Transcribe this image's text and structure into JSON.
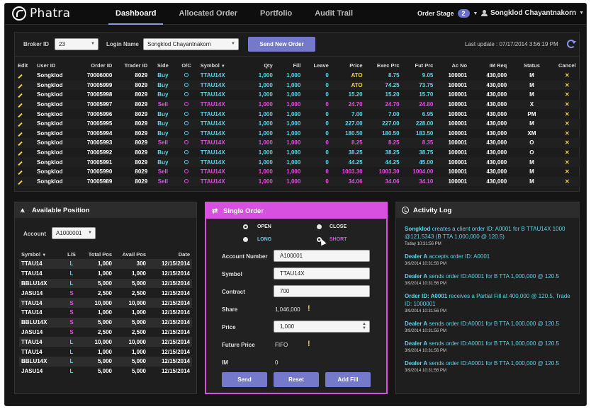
{
  "app": {
    "name": "Phatra"
  },
  "nav": {
    "tabs": [
      {
        "label": "Dashboard"
      },
      {
        "label": "Allocated Order"
      },
      {
        "label": "Portfolio"
      },
      {
        "label": "Audit Trail"
      }
    ]
  },
  "header": {
    "order_stage_label": "Order Stage",
    "order_stage_count": "2",
    "user_name": "Songklod Chayantnakorn"
  },
  "filters": {
    "broker_id_label": "Broker ID",
    "broker_id_value": "23",
    "login_name_label": "Login Name",
    "login_name_value": "Songklod Chayantnakorn",
    "send_new_order_label": "Send New Order",
    "last_update": "Last update : 07/17/2014   3:56:19 PM"
  },
  "orders": {
    "columns": [
      "Edit",
      "User ID",
      "Order ID",
      "Trader ID",
      "Side",
      "O/C",
      "Symbol",
      "Qty",
      "Fill",
      "Leave",
      "Price",
      "Exec Prc",
      "Fut Prc",
      "Ac No",
      "IM Req",
      "Status",
      "Cancel"
    ],
    "rows": [
      {
        "user": "Songklod",
        "order_id": "70006000",
        "trader": "8029",
        "side": "Buy",
        "symbol": "TTAU14X",
        "qty": "1,000",
        "fill": "1,000",
        "leave": "0",
        "price": "ATO",
        "exec": "8.75",
        "fut": "9.05",
        "acno": "100001",
        "im": "430,000",
        "status": "M"
      },
      {
        "user": "Songklod",
        "order_id": "70005999",
        "trader": "8029",
        "side": "Buy",
        "symbol": "TTAU14X",
        "qty": "1,000",
        "fill": "1,000",
        "leave": "0",
        "price": "ATO",
        "exec": "74.25",
        "fut": "73.75",
        "acno": "100001",
        "im": "430,000",
        "status": "M"
      },
      {
        "user": "Songklod",
        "order_id": "70005998",
        "trader": "8029",
        "side": "Buy",
        "symbol": "TTAU14X",
        "qty": "1,000",
        "fill": "1,000",
        "leave": "0",
        "price": "15.20",
        "exec": "15.20",
        "fut": "15.70",
        "acno": "100001",
        "im": "430,000",
        "status": "M"
      },
      {
        "user": "Songklod",
        "order_id": "70005997",
        "trader": "8029",
        "side": "Sell",
        "symbol": "TTAU14X",
        "qty": "1,000",
        "fill": "1,000",
        "leave": "0",
        "price": "24.70",
        "exec": "24.70",
        "fut": "24.80",
        "acno": "100001",
        "im": "430,000",
        "status": "X"
      },
      {
        "user": "Songklod",
        "order_id": "70005996",
        "trader": "8029",
        "side": "Buy",
        "symbol": "TTAU14X",
        "qty": "1,000",
        "fill": "1,000",
        "leave": "0",
        "price": "7.00",
        "exec": "7.00",
        "fut": "6.95",
        "acno": "100001",
        "im": "430,000",
        "status": "PM"
      },
      {
        "user": "Songklod",
        "order_id": "70005995",
        "trader": "8029",
        "side": "Buy",
        "symbol": "TTAU14X",
        "qty": "1,000",
        "fill": "1,000",
        "leave": "0",
        "price": "227.00",
        "exec": "227.00",
        "fut": "228.00",
        "acno": "100001",
        "im": "430,000",
        "status": "M"
      },
      {
        "user": "Songklod",
        "order_id": "70005994",
        "trader": "8029",
        "side": "Buy",
        "symbol": "TTAU14X",
        "qty": "1,000",
        "fill": "1,000",
        "leave": "0",
        "price": "180.50",
        "exec": "180.50",
        "fut": "183.50",
        "acno": "100001",
        "im": "430,000",
        "status": "XM"
      },
      {
        "user": "Songklod",
        "order_id": "70005993",
        "trader": "8029",
        "side": "Sell",
        "symbol": "TTAU14X",
        "qty": "1,000",
        "fill": "1,000",
        "leave": "0",
        "price": "8.25",
        "exec": "8.25",
        "fut": "8.35",
        "acno": "100001",
        "im": "430,000",
        "status": "O"
      },
      {
        "user": "Songklod",
        "order_id": "70005992",
        "trader": "8029",
        "side": "Buy",
        "symbol": "TTAU14X",
        "qty": "1,000",
        "fill": "1,000",
        "leave": "0",
        "price": "38.25",
        "exec": "38.25",
        "fut": "38.75",
        "acno": "100001",
        "im": "430,000",
        "status": "O"
      },
      {
        "user": "Songklod",
        "order_id": "70005991",
        "trader": "8029",
        "side": "Buy",
        "symbol": "TTAU14X",
        "qty": "1,000",
        "fill": "1,000",
        "leave": "0",
        "price": "44.25",
        "exec": "44.25",
        "fut": "45.00",
        "acno": "100001",
        "im": "430,000",
        "status": "M"
      },
      {
        "user": "Songklod",
        "order_id": "70005990",
        "trader": "8029",
        "side": "Sell",
        "symbol": "TTAU14X",
        "qty": "1,000",
        "fill": "1,000",
        "leave": "0",
        "price": "1003.30",
        "exec": "1003.30",
        "fut": "1004.00",
        "acno": "100001",
        "im": "430,000",
        "status": "M"
      },
      {
        "user": "Songklod",
        "order_id": "70005989",
        "trader": "8029",
        "side": "Sell",
        "symbol": "TTAU14X",
        "qty": "1,000",
        "fill": "1,000",
        "leave": "0",
        "price": "34.06",
        "exec": "34.06",
        "fut": "34.10",
        "acno": "100001",
        "im": "430,000",
        "status": "M"
      }
    ]
  },
  "available_position": {
    "title": "Available Position",
    "account_label": "Account",
    "account_value": "A1000001",
    "columns": [
      "Symbol",
      "L/S",
      "Total Pos",
      "Avail Pos",
      "Date"
    ],
    "rows": [
      {
        "symbol": "TTAU14",
        "ls": "L",
        "total": "1,000",
        "avail": "300",
        "date": "12/15/2014"
      },
      {
        "symbol": "TTAU14",
        "ls": "L",
        "total": "1,000",
        "avail": "1,000",
        "date": "12/15/2014"
      },
      {
        "symbol": "BBLU14X",
        "ls": "L",
        "total": "5,000",
        "avail": "5,000",
        "date": "12/15/2014"
      },
      {
        "symbol": "JASU14",
        "ls": "S",
        "total": "2,500",
        "avail": "2,500",
        "date": "12/15/2014"
      },
      {
        "symbol": "TTAU14",
        "ls": "S",
        "total": "10,000",
        "avail": "10,000",
        "date": "12/15/2014"
      },
      {
        "symbol": "TTAU14",
        "ls": "S",
        "total": "1,000",
        "avail": "1,000",
        "date": "12/15/2014"
      },
      {
        "symbol": "BBLU14X",
        "ls": "S",
        "total": "5,000",
        "avail": "5,000",
        "date": "12/15/2014"
      },
      {
        "symbol": "JASU14",
        "ls": "S",
        "total": "2,500",
        "avail": "2,500",
        "date": "12/15/2014"
      },
      {
        "symbol": "TTAU14",
        "ls": "L",
        "total": "10,000",
        "avail": "10,000",
        "date": "12/15/2014"
      },
      {
        "symbol": "TTAU14",
        "ls": "L",
        "total": "1,000",
        "avail": "1,000",
        "date": "12/15/2014"
      },
      {
        "symbol": "BBLU14X",
        "ls": "L",
        "total": "5,000",
        "avail": "5,000",
        "date": "12/15/2014"
      },
      {
        "symbol": "JASU14",
        "ls": "L",
        "total": "5,000",
        "avail": "5,000",
        "date": "12/15/2014"
      }
    ]
  },
  "single_order": {
    "title": "Single Order",
    "open_label": "OPEN",
    "close_label": "CLOSE",
    "long_label": "LONG",
    "short_label": "SHORT",
    "account_number_label": "Account Number",
    "account_number_value": "A100001",
    "symbol_label": "Symbol",
    "symbol_value": "TTAU14X",
    "contract_label": "Contract",
    "contract_value": "700",
    "share_label": "Share",
    "share_value": "1,046,000",
    "price_label": "Price",
    "price_value": "1,000",
    "future_price_label": "Future Price",
    "future_price_value": "FIFO",
    "im_label": "IM",
    "im_value": "0",
    "send_label": "Send",
    "reset_label": "Reset",
    "add_fill_label": "Add Fill"
  },
  "activity_log": {
    "title": "Activity Log",
    "items": [
      {
        "actor": "Songklod",
        "text": " creates a client order ID: A0001 for B TTAU14X 1000 @121.5343 (B TTA 1,000,000 @ 120.5)",
        "time": "Today  10:31:56 PM"
      },
      {
        "actor": "Dealer A",
        "text": " accepts order ID: A0001",
        "time": "3/9/2014  10:31:56 PM"
      },
      {
        "actor": "Dealer A",
        "text": " sends order ID:A0001 for B TTA 1,000,000 @ 120.5",
        "time": "3/9/2014  10:31:56 PM"
      },
      {
        "actor": "Order ID: A0001",
        "text": " receives a Partial Fill at 400,000 @ 120.5, Trade ID: 1000001",
        "time": "3/9/2014  10:31:56 PM"
      },
      {
        "actor": "Dealer A",
        "text": " sends order ID:A0001 for B TTA 1,000,000 @ 120.5",
        "time": "3/9/2014  10:31:56 PM"
      },
      {
        "actor": "Dealer A",
        "text": " sends order ID:A0001 for B TTA 1,000,000 @ 120.5",
        "time": "3/9/2014  10:31:56 PM"
      },
      {
        "actor": "Dealer A",
        "text": " sends order ID:A0001 for B TTA 1,000,000 @ 120.5",
        "time": "3/9/2014  10:31:56 PM"
      }
    ]
  },
  "colors": {
    "accent": "#7479c9",
    "buy": "#5ed3ea",
    "sell": "#e04fe0",
    "warning": "#f3d43b",
    "single_order_header": "#d750e0"
  }
}
